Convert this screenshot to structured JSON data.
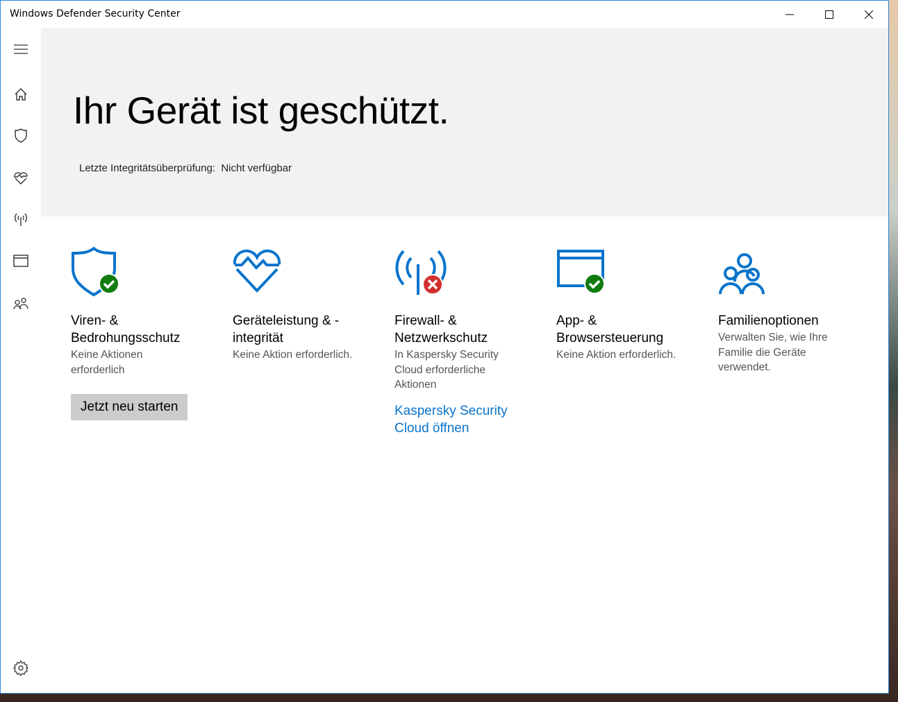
{
  "window": {
    "title": "Windows Defender Security Center"
  },
  "hero": {
    "title": "Ihr Gerät ist geschützt.",
    "last_check_label": "Letzte Integritätsüberprüfung:",
    "last_check_value": "Nicht verfügbar"
  },
  "tiles": [
    {
      "title": "Viren- & Bedrohungsschutz",
      "desc": "Keine Aktionen erforderlich",
      "button": "Jetzt neu starten",
      "status": "ok"
    },
    {
      "title": "Geräteleistung & -integrität",
      "desc": "Keine Aktion erforderlich."
    },
    {
      "title": "Firewall- & Netzwerkschutz",
      "desc": "In Kaspersky Security Cloud erforderliche Aktionen",
      "link": "Kaspersky Security Cloud öffnen",
      "status": "error"
    },
    {
      "title": "App- & Browsersteuerung",
      "desc": "Keine Aktion erforderlich.",
      "status": "ok"
    },
    {
      "title": "Familienoptionen",
      "desc": "Verwalten Sie, wie Ihre Familie die Geräte verwendet."
    }
  ],
  "colors": {
    "accent": "#0a74cc",
    "ok": "#107c10",
    "error": "#d32f2f"
  }
}
